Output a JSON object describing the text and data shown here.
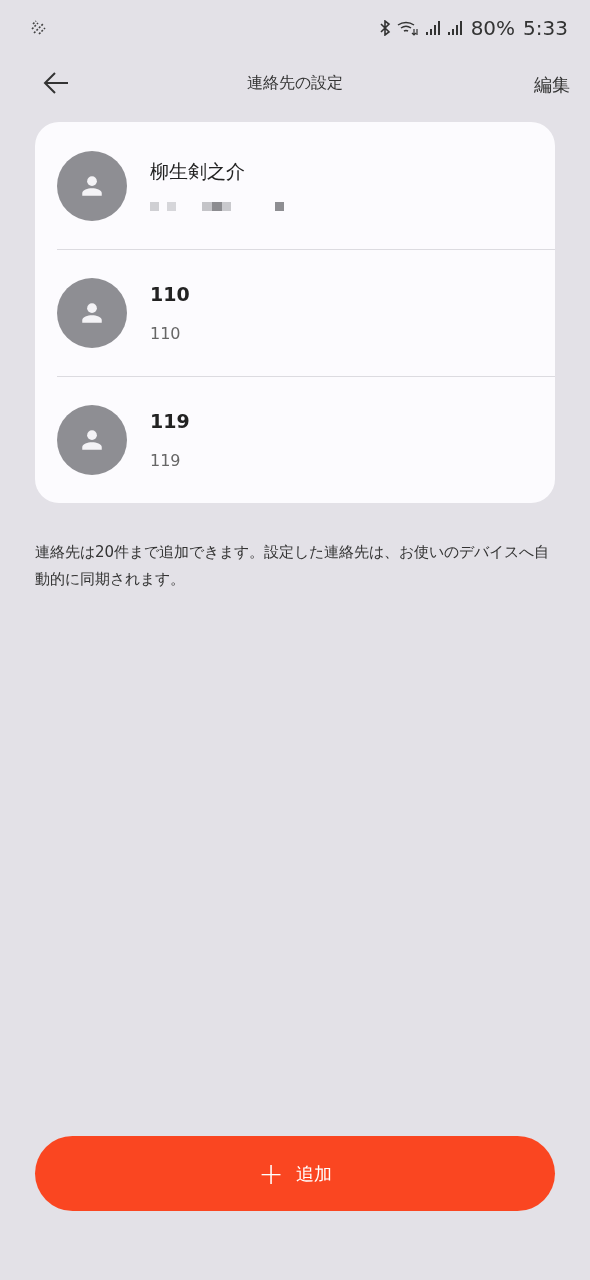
{
  "status_bar": {
    "battery": "80%",
    "time": "5:33"
  },
  "header": {
    "title": "連絡先の設定",
    "action": "編集"
  },
  "contacts": [
    {
      "name": "柳生剣之介",
      "bold": false
    },
    {
      "name": "110",
      "bold": true,
      "number": "110"
    },
    {
      "name": "119",
      "bold": true,
      "number": "119"
    }
  ],
  "note": "連絡先は20件まで追加できます。設定した連絡先は、お使いのデバイスへ自動的に同期されます。",
  "add_button": {
    "icon": "+",
    "label": "追加"
  }
}
